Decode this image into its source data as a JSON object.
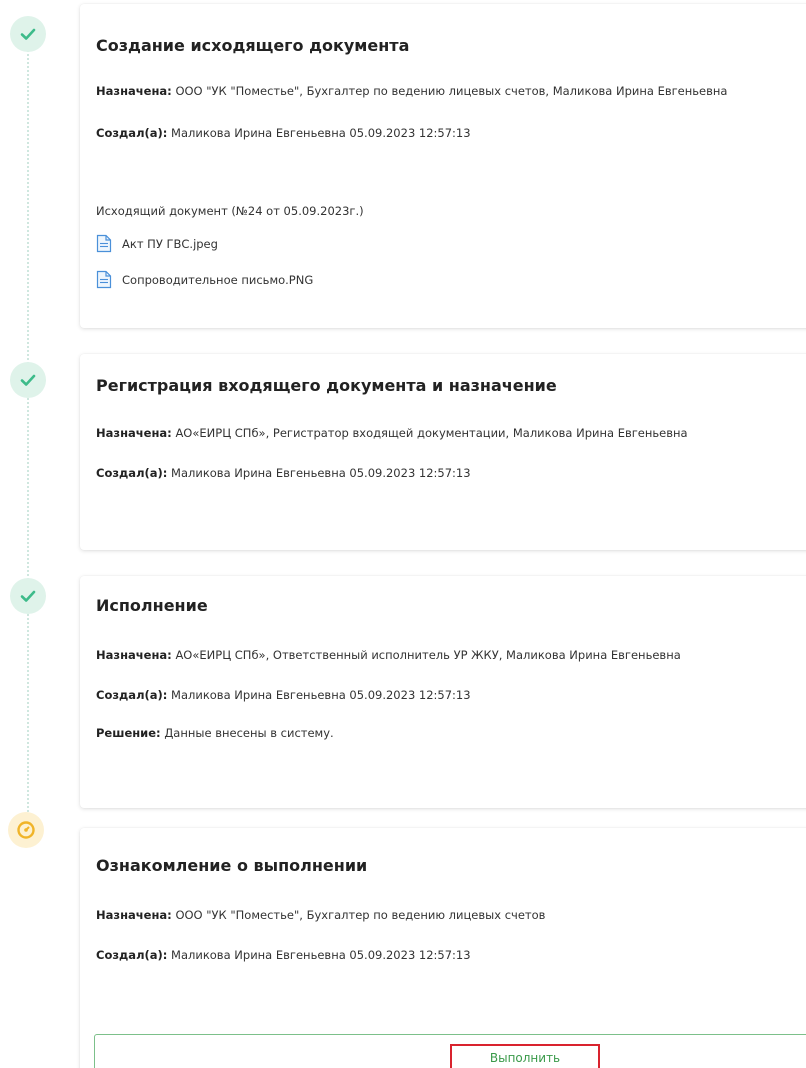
{
  "steps": [
    {
      "status": "done",
      "status_icon": "check-icon",
      "title": "Создание исходящего документа",
      "assigned_label": "Назначена:",
      "assigned_value": "ООО \"УК \"Поместье\", Бухгалтер по ведению лицевых счетов, Маликова Ирина Евгеньевна",
      "created_label": "Создал(а):",
      "created_value": "Маликова Ирина Евгеньевна 05.09.2023 12:57:13",
      "outgoing_doc": "Исходящий документ (№24 от 05.09.2023г.)",
      "files": [
        {
          "name": "Акт ПУ ГВС.jpeg",
          "icon": "document-icon"
        },
        {
          "name": "Сопроводительное письмо.PNG",
          "icon": "document-icon"
        }
      ]
    },
    {
      "status": "done",
      "status_icon": "check-icon",
      "title": "Регистрация входящего документа и назначение",
      "assigned_label": "Назначена:",
      "assigned_value": "АО«ЕИРЦ СПб», Регистратор входящей документации, Маликова Ирина Евгеньевна",
      "created_label": "Создал(а):",
      "created_value": "Маликова Ирина Евгеньевна 05.09.2023 12:57:13"
    },
    {
      "status": "done",
      "status_icon": "check-icon",
      "title": "Исполнение",
      "assigned_label": "Назначена:",
      "assigned_value": "АО«ЕИРЦ СПб», Ответственный исполнитель УР ЖКУ, Маликова Ирина Евгеньевна",
      "created_label": "Создал(а):",
      "created_value": "Маликова Ирина Евгеньевна 05.09.2023 12:57:13",
      "decision_label": "Решение:",
      "decision_value": "Данные внесены в систему."
    },
    {
      "status": "pending",
      "status_icon": "pending-icon",
      "title": "Ознакомление о выполнении",
      "assigned_label": "Назначена:",
      "assigned_value": "ООО \"УК \"Поместье\", Бухгалтер по ведению лицевых счетов",
      "created_label": "Создал(а):",
      "created_value": "Маликова Ирина Евгеньевна 05.09.2023 12:57:13",
      "action_label": "Выполнить"
    }
  ],
  "colors": {
    "done": "#3dbb8a",
    "done_bg": "#dff3ea",
    "pending": "#f0b429",
    "pending_bg": "#fdf1d2",
    "action_text": "#3a9a4a",
    "action_highlight": "#d9232e",
    "action_border": "#7cc08a"
  }
}
